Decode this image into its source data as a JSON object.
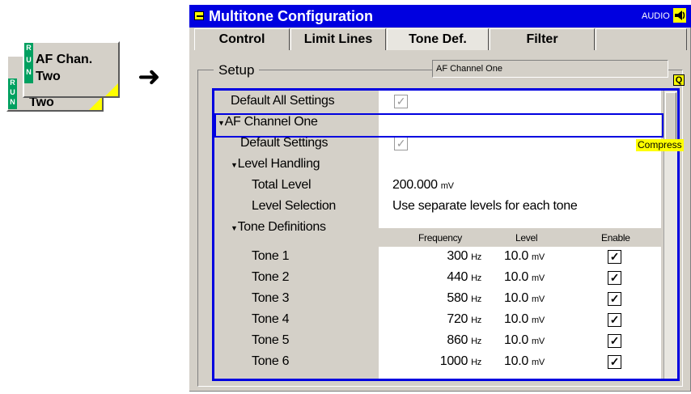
{
  "softkey": {
    "run_letters": [
      "R",
      "U",
      "N"
    ],
    "front_line1": "AF Chan.",
    "front_line2": "Two",
    "back_line": "Two",
    "arrow": "➜"
  },
  "window": {
    "title": "Multitone Configuration",
    "mode_label": "AUDIO",
    "mode_icon": "speaker-icon"
  },
  "tabs": [
    {
      "label": "Control"
    },
    {
      "label": "Limit Lines"
    },
    {
      "label": "Tone Def."
    },
    {
      "label": "Filter"
    }
  ],
  "active_tab": "Tone Def.",
  "setup": {
    "label": "Setup",
    "channel_display": "AF Channel One",
    "q_badge": "Q",
    "compress_badge": "Compress"
  },
  "tree": {
    "default_all": {
      "label": "Default All Settings",
      "checked": true
    },
    "channel": {
      "label": "AF Channel One"
    },
    "default_settings": {
      "label": "Default Settings",
      "checked": true
    },
    "level_handling": {
      "label": "Level Handling"
    },
    "total_level": {
      "label": "Total Level",
      "value": "200.000",
      "unit": "mV"
    },
    "level_selection": {
      "label": "Level Selection",
      "value": "Use separate levels for each tone"
    },
    "tone_definitions": {
      "label": "Tone Definitions"
    },
    "columns": [
      "Frequency",
      "Level",
      "Enable"
    ],
    "tones": [
      {
        "name": "Tone 1",
        "freq": "300",
        "freq_unit": "Hz",
        "level": "10.0",
        "level_unit": "mV",
        "enabled": true
      },
      {
        "name": "Tone 2",
        "freq": "440",
        "freq_unit": "Hz",
        "level": "10.0",
        "level_unit": "mV",
        "enabled": true
      },
      {
        "name": "Tone 3",
        "freq": "580",
        "freq_unit": "Hz",
        "level": "10.0",
        "level_unit": "mV",
        "enabled": true
      },
      {
        "name": "Tone 4",
        "freq": "720",
        "freq_unit": "Hz",
        "level": "10.0",
        "level_unit": "mV",
        "enabled": true
      },
      {
        "name": "Tone 5",
        "freq": "860",
        "freq_unit": "Hz",
        "level": "10.0",
        "level_unit": "mV",
        "enabled": true
      },
      {
        "name": "Tone 6",
        "freq": "1000",
        "freq_unit": "Hz",
        "level": "10.0",
        "level_unit": "mV",
        "enabled": true
      }
    ]
  },
  "colors": {
    "title_bar": "#0000e0",
    "focus_border": "#0000e0",
    "run_green": "#00a060",
    "badge_yellow": "#ffff00"
  }
}
